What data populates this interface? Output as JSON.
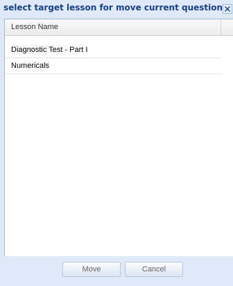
{
  "dialog": {
    "title": "select target lesson for move current question",
    "close_icon": "close-icon"
  },
  "grid": {
    "column_header": "Lesson Name",
    "rows": [
      "Diagnostic Test - Part I",
      "Numericals"
    ]
  },
  "buttons": {
    "move_label": "Move",
    "cancel_label": "Cancel"
  },
  "colors": {
    "dialog_background": "#dfe8f6",
    "title_text": "#15428b",
    "border": "#99bbe8"
  }
}
